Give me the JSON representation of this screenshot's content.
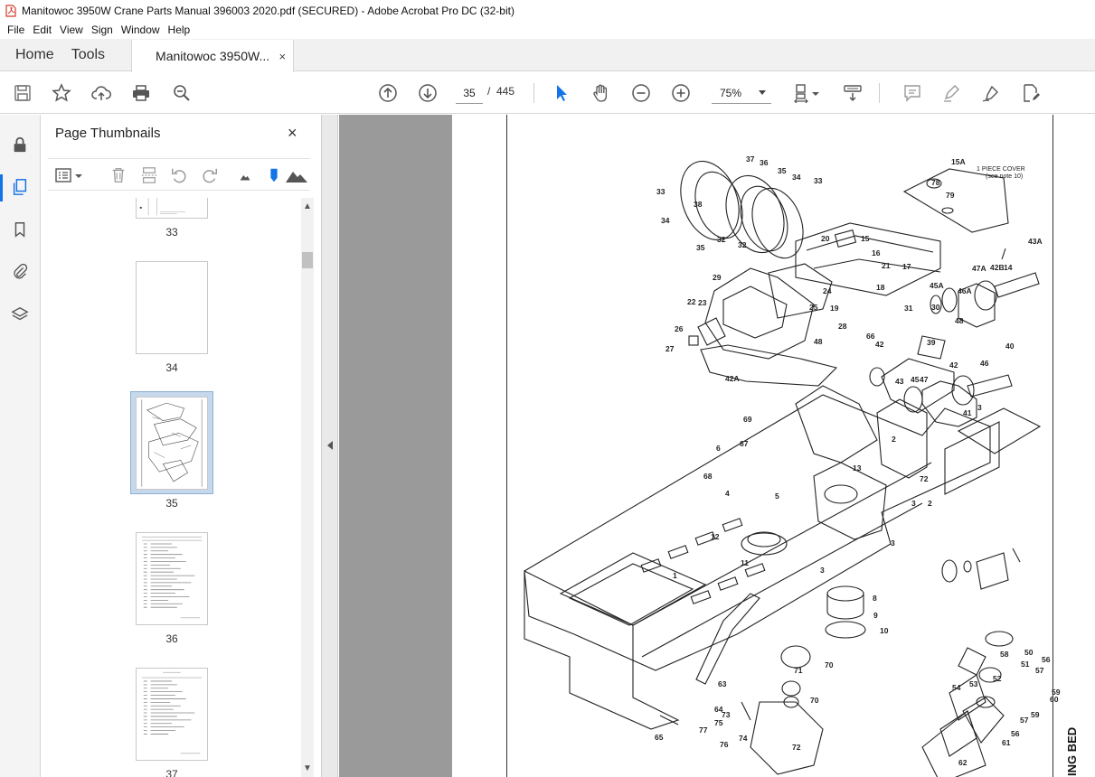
{
  "window": {
    "title": "Manitowoc 3950W Crane Parts Manual 396003 2020.pdf (SECURED) - Adobe Acrobat Pro DC (32-bit)"
  },
  "menu": [
    "File",
    "Edit",
    "View",
    "Sign",
    "Window",
    "Help"
  ],
  "tabs": {
    "home": "Home",
    "tools": "Tools",
    "document": "Manitowoc 3950W...",
    "close": "×"
  },
  "toolbar": {
    "current_page": "35",
    "separator": "/",
    "total_pages": "445",
    "zoom": "75%"
  },
  "thumbnail_panel": {
    "title": "Page Thumbnails",
    "close": "×",
    "pages": [
      "33",
      "34",
      "35",
      "36",
      "37"
    ],
    "selected_page": "35"
  },
  "document": {
    "side_caption": "ING BED",
    "callouts": {
      "cover": "1 PIECE COVER",
      "cover_note": "(see note 10)",
      "labels": [
        "33",
        "37",
        "36",
        "35",
        "34",
        "33",
        "15A",
        "78",
        "79",
        "34",
        "38",
        "35",
        "32",
        "32",
        "20",
        "15",
        "16",
        "21",
        "17",
        "18",
        "31",
        "30",
        "29",
        "22",
        "23",
        "24",
        "25",
        "19",
        "28",
        "66",
        "26",
        "27",
        "48",
        "42A",
        "43A",
        "45A",
        "46A",
        "47A",
        "42B",
        "14",
        "48",
        "39",
        "40",
        "42",
        "43",
        "45",
        "47",
        "42",
        "46",
        "41",
        "3",
        "2",
        "69",
        "6",
        "67",
        "13",
        "72",
        "68",
        "4",
        "5",
        "3",
        "2",
        "3",
        "12",
        "11",
        "1",
        "3",
        "8",
        "9",
        "10",
        "54",
        "53",
        "52",
        "51",
        "50",
        "63",
        "71",
        "70",
        "70",
        "64",
        "73",
        "75",
        "77",
        "76",
        "74",
        "65",
        "72",
        "58",
        "56",
        "57",
        "59",
        "60",
        "59",
        "57",
        "56",
        "61",
        "62"
      ]
    }
  },
  "colors": {
    "accent": "#1473e6",
    "tab_bg": "#f1f1f1",
    "doc_bg": "#9a9a9a",
    "selection": "#c5d8ec"
  }
}
